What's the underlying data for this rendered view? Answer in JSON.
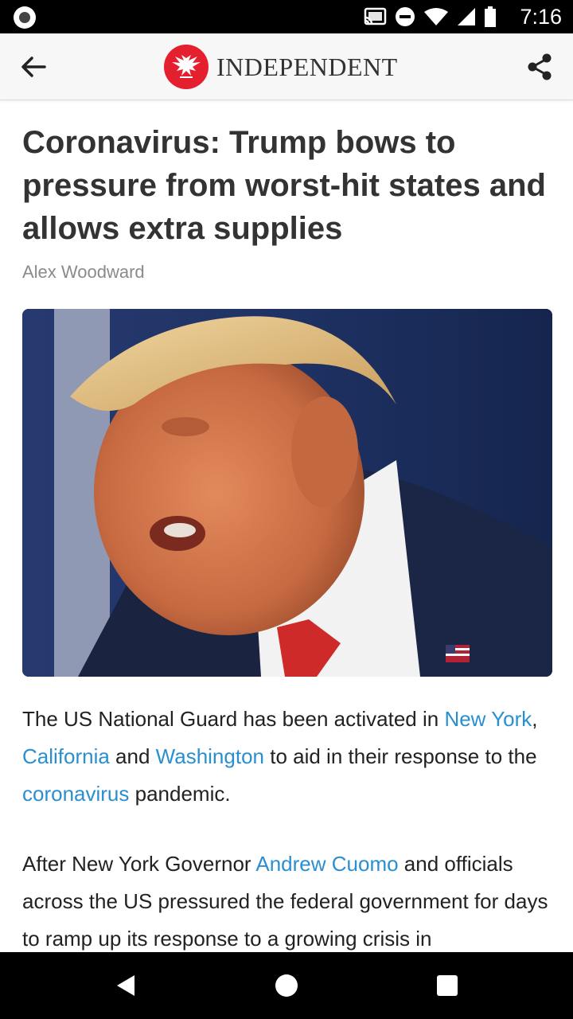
{
  "status_bar": {
    "time": "7:16",
    "icons": [
      "notification-dot-icon",
      "cast-icon",
      "do-not-disturb-icon",
      "wifi-icon",
      "signal-icon",
      "battery-icon"
    ]
  },
  "app_bar": {
    "back_icon": "arrow-left-icon",
    "brand_name": "INDEPENDENT",
    "share_icon": "share-icon"
  },
  "article": {
    "headline": "Coronavirus: Trump bows to pressure from worst-hit states and allows extra supplies",
    "byline": "Alex Woodward",
    "paragraph_1": {
      "t1": "The US National Guard has been activated in ",
      "link1": "New York",
      "t2": ", ",
      "link2": "California",
      "t3": " and ",
      "link3": "Washington",
      "t4": " to aid in their response to the ",
      "link4": "coronavirus",
      "t5": " pandemic."
    },
    "paragraph_2": {
      "t1": "After New York Governor ",
      "link1": "Andrew Cuomo",
      "t2": " and officials across the US pressured the federal government for days to ramp up its response to a growing crisis in"
    }
  },
  "colors": {
    "brand_red": "#e5202e",
    "link": "#2a8fd0",
    "headline": "#333333",
    "byline": "#8a8a8a"
  },
  "nav_bar": {
    "icons": [
      "back-triangle-icon",
      "home-circle-icon",
      "recents-square-icon"
    ]
  }
}
